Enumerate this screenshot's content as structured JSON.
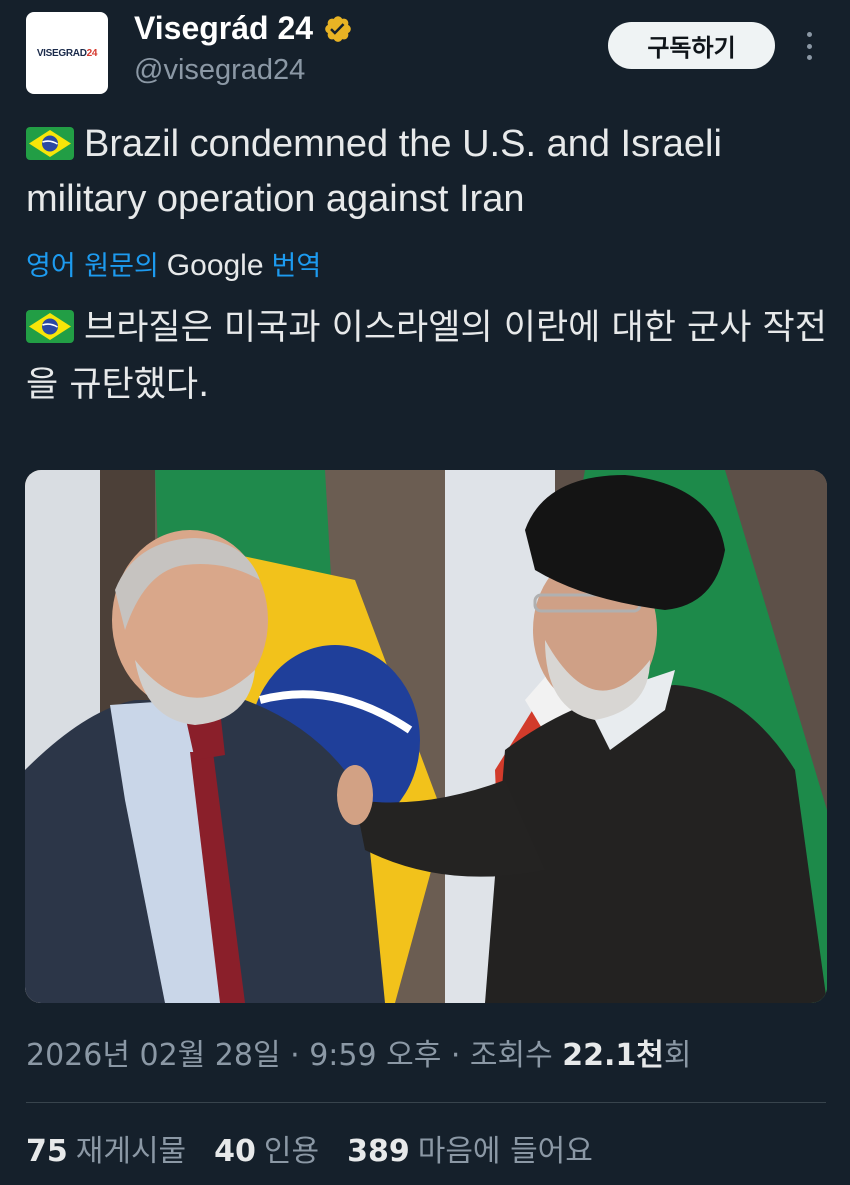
{
  "account": {
    "display_name": "Visegrád 24",
    "handle": "@visegrad24",
    "avatar_text": "VISEGRAD",
    "avatar_text_accent": "24",
    "verified_icon": "gold-verified-badge",
    "verified_color": "#e8b324"
  },
  "actions": {
    "subscribe_label": "구독하기",
    "more_icon": "more-vertical-icon"
  },
  "tweet": {
    "flag_icon": "brazil-flag-emoji",
    "text": "Brazil condemned the U.S. and Israeli military operation against Iran",
    "translate": {
      "language_label": "영어 원문의",
      "provider": "Google",
      "action_label": "번역"
    },
    "translated_text": "브라질은 미국과 이스라엘의 이란에 대한 군사 작전을 규탄했다."
  },
  "meta": {
    "date": "2026년 02월 28일",
    "separator": " · ",
    "time": "9:59 오후",
    "views_label": "조회수",
    "views_count": "22.1천",
    "views_suffix": "회"
  },
  "stats": {
    "reposts_count": "75",
    "reposts_label": "재게시물",
    "quotes_count": "40",
    "quotes_label": "인용",
    "likes_count": "389",
    "likes_label": "마음에 들어요"
  },
  "colors": {
    "background": "#15202b",
    "secondary_text": "#8b98a5",
    "link": "#1d9bf0",
    "divider": "#38444d"
  }
}
